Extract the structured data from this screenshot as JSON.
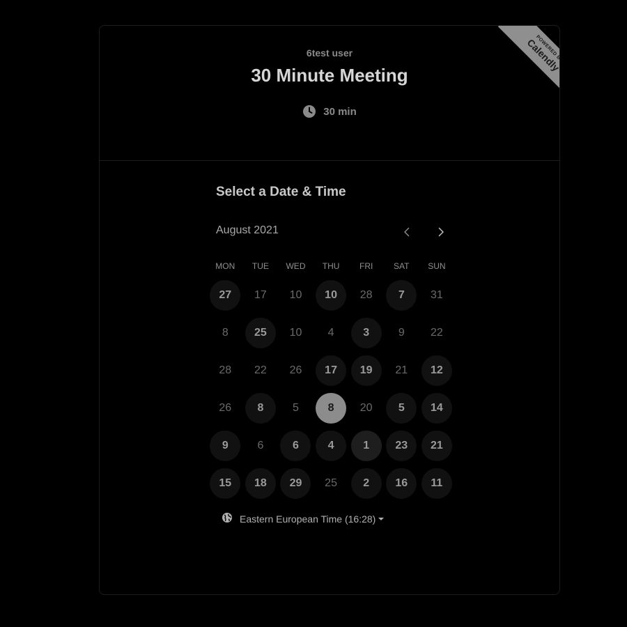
{
  "header": {
    "host_name": "6test user",
    "event_title": "30 Minute Meeting",
    "duration": "30 min",
    "badge": {
      "top_text": "POWERED BY",
      "brand": "Calendly"
    }
  },
  "scheduler": {
    "section_title": "Select a Date & Time",
    "month_label": "August 2021",
    "weekdays": [
      "MON",
      "TUE",
      "WED",
      "THU",
      "FRI",
      "SAT",
      "SUN"
    ],
    "weeks": [
      [
        {
          "d": "27",
          "s": "available"
        },
        {
          "d": "17",
          "s": "unavailable"
        },
        {
          "d": "10",
          "s": "unavailable"
        },
        {
          "d": "10",
          "s": "available"
        },
        {
          "d": "28",
          "s": "unavailable"
        },
        {
          "d": "7",
          "s": "available"
        },
        {
          "d": "31",
          "s": "unavailable"
        }
      ],
      [
        {
          "d": "8",
          "s": "unavailable"
        },
        {
          "d": "25",
          "s": "available"
        },
        {
          "d": "10",
          "s": "unavailable"
        },
        {
          "d": "4",
          "s": "unavailable"
        },
        {
          "d": "3",
          "s": "available"
        },
        {
          "d": "9",
          "s": "unavailable"
        },
        {
          "d": "22",
          "s": "unavailable"
        }
      ],
      [
        {
          "d": "28",
          "s": "unavailable"
        },
        {
          "d": "22",
          "s": "unavailable"
        },
        {
          "d": "26",
          "s": "unavailable"
        },
        {
          "d": "17",
          "s": "available"
        },
        {
          "d": "19",
          "s": "available"
        },
        {
          "d": "21",
          "s": "unavailable"
        },
        {
          "d": "12",
          "s": "available"
        }
      ],
      [
        {
          "d": "26",
          "s": "unavailable"
        },
        {
          "d": "8",
          "s": "available"
        },
        {
          "d": "5",
          "s": "unavailable"
        },
        {
          "d": "8",
          "s": "selected"
        },
        {
          "d": "20",
          "s": "unavailable"
        },
        {
          "d": "5",
          "s": "available"
        },
        {
          "d": "14",
          "s": "available"
        }
      ],
      [
        {
          "d": "9",
          "s": "available"
        },
        {
          "d": "6",
          "s": "unavailable"
        },
        {
          "d": "6",
          "s": "available"
        },
        {
          "d": "4",
          "s": "available"
        },
        {
          "d": "1",
          "s": "today"
        },
        {
          "d": "23",
          "s": "available"
        },
        {
          "d": "21",
          "s": "available"
        }
      ],
      [
        {
          "d": "15",
          "s": "available"
        },
        {
          "d": "18",
          "s": "available"
        },
        {
          "d": "29",
          "s": "available"
        },
        {
          "d": "25",
          "s": "unavailable"
        },
        {
          "d": "2",
          "s": "available"
        },
        {
          "d": "16",
          "s": "available"
        },
        {
          "d": "11",
          "s": "available"
        }
      ]
    ],
    "timezone_label": "Eastern European Time (16:28)"
  },
  "icons": {
    "duration": "clock-icon",
    "prev": "chevron-left-icon",
    "next": "chevron-right-icon",
    "timezone": "globe-icon",
    "timezone_dropdown": "caret-down-icon"
  },
  "colors": {
    "background": "#000000",
    "selected_day": "#8c8c8c",
    "available_day": "#111111"
  }
}
